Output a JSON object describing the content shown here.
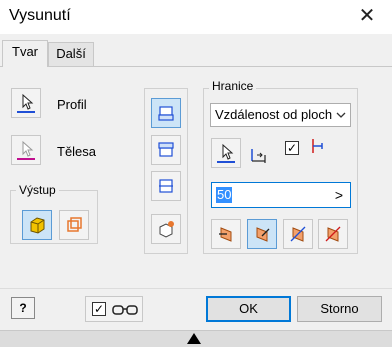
{
  "window": {
    "title": "Vysunutí",
    "close_icon": "close-icon"
  },
  "tabs": [
    {
      "label": "Tvar",
      "active": true
    },
    {
      "label": "Další",
      "active": false
    }
  ],
  "left": {
    "profile_label": "Profil",
    "solids_label": "Tělesa",
    "output_group": "Výstup"
  },
  "limits": {
    "group_title": "Hranice",
    "extent_value": "Vzdálenost od ploch",
    "distance_value": "50",
    "arrow_glyph": ">"
  },
  "footer": {
    "help_glyph": "?",
    "ok_label": "OK",
    "cancel_label": "Storno",
    "preview_checked": true
  },
  "colors": {
    "accent": "#0078d7",
    "selected_bg": "#cce4f7",
    "profile_line": "#1f4fd6",
    "solids_line": "#c0108e",
    "output_orange": "#e8772e",
    "output_yellow": "#f2c200"
  }
}
